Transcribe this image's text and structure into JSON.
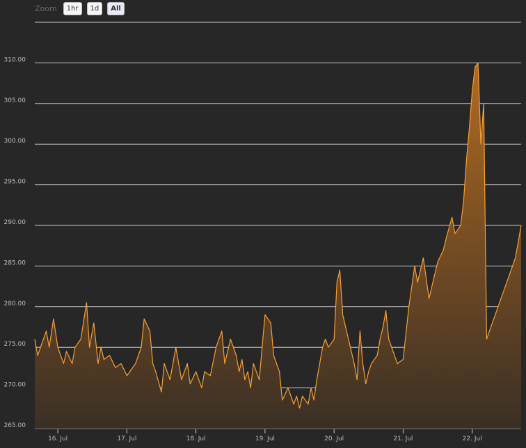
{
  "zoom": {
    "label": "Zoom",
    "buttons": [
      {
        "label": "1hr",
        "active": false
      },
      {
        "label": "1d",
        "active": false
      },
      {
        "label": "All",
        "active": true
      }
    ]
  },
  "colors": {
    "background": "#272727",
    "grid": "#c8c8c8",
    "line": "#f7a135",
    "fill_top": "#b06a21",
    "fill_bottom": "#3a2f25"
  },
  "chart_data": {
    "type": "area",
    "title": "",
    "xlabel": "",
    "ylabel": "",
    "grid": true,
    "legend": "none",
    "ylim": [
      265,
      315
    ],
    "yticks": [
      265,
      270,
      275,
      280,
      285,
      290,
      295,
      300,
      305,
      310
    ],
    "ytick_labels": [
      "265.00",
      "270.00",
      "275.00",
      "280.00",
      "285.00",
      "290.00",
      "295.00",
      "300.00",
      "305.00",
      "310.00"
    ],
    "xlim": [
      "2015-07-15T16:00",
      "2015-07-22T17:00"
    ],
    "xticks": [
      "2015-07-16",
      "2015-07-17",
      "2015-07-18",
      "2015-07-19",
      "2015-07-20",
      "2015-07-21",
      "2015-07-22"
    ],
    "xtick_labels": [
      "16. Jul",
      "17. Jul",
      "18. Jul",
      "19. Jul",
      "20. Jul",
      "21. Jul",
      "22. Jul"
    ],
    "series": [
      {
        "x": [
          "2015-07-15T16:00",
          "2015-07-15T17:00",
          "2015-07-15T19:00",
          "2015-07-15T20:00",
          "2015-07-15T21:00",
          "2015-07-15T22:30",
          "2015-07-16T00:00",
          "2015-07-16T01:00",
          "2015-07-16T02:00",
          "2015-07-16T03:00",
          "2015-07-16T05:00",
          "2015-07-16T06:00",
          "2015-07-16T08:00",
          "2015-07-16T10:00",
          "2015-07-16T11:00",
          "2015-07-16T12:00",
          "2015-07-16T12:30",
          "2015-07-16T14:00",
          "2015-07-16T15:00",
          "2015-07-16T16:00",
          "2015-07-16T18:00",
          "2015-07-16T20:00",
          "2015-07-16T22:00",
          "2015-07-17T00:00",
          "2015-07-17T03:00",
          "2015-07-17T05:00",
          "2015-07-17T06:00",
          "2015-07-17T08:00",
          "2015-07-17T09:00",
          "2015-07-17T10:00",
          "2015-07-17T12:00",
          "2015-07-17T13:00",
          "2015-07-17T15:00",
          "2015-07-17T17:00",
          "2015-07-17T19:00",
          "2015-07-17T21:00",
          "2015-07-17T22:00",
          "2015-07-18T00:00",
          "2015-07-18T02:00",
          "2015-07-18T03:00",
          "2015-07-18T05:00",
          "2015-07-18T07:00",
          "2015-07-18T09:00",
          "2015-07-18T10:00",
          "2015-07-18T12:00",
          "2015-07-18T14:00",
          "2015-07-18T15:00",
          "2015-07-18T16:00",
          "2015-07-18T17:00",
          "2015-07-18T18:00",
          "2015-07-18T19:00",
          "2015-07-18T20:00",
          "2015-07-18T22:00",
          "2015-07-19T00:00",
          "2015-07-19T02:00",
          "2015-07-19T03:00",
          "2015-07-19T05:00",
          "2015-07-19T06:00",
          "2015-07-19T08:00",
          "2015-07-19T10:00",
          "2015-07-19T11:00",
          "2015-07-19T12:00",
          "2015-07-19T13:00",
          "2015-07-19T15:00",
          "2015-07-19T16:00",
          "2015-07-19T17:00",
          "2015-07-19T18:00",
          "2015-07-19T19:00",
          "2015-07-19T20:00",
          "2015-07-19T21:00",
          "2015-07-19T22:00",
          "2015-07-20T00:00",
          "2015-07-20T01:00",
          "2015-07-20T02:00",
          "2015-07-20T03:00",
          "2015-07-20T05:00",
          "2015-07-20T07:00",
          "2015-07-20T08:00",
          "2015-07-20T09:00",
          "2015-07-20T10:00",
          "2015-07-20T11:00",
          "2015-07-20T12:00",
          "2015-07-20T13:00",
          "2015-07-20T15:00",
          "2015-07-20T16:00",
          "2015-07-20T17:00",
          "2015-07-20T18:00",
          "2015-07-20T19:00",
          "2015-07-20T20:00",
          "2015-07-20T21:00",
          "2015-07-20T22:00",
          "2015-07-21T00:00",
          "2015-07-21T02:00",
          "2015-07-21T04:00",
          "2015-07-21T05:00",
          "2015-07-21T07:00",
          "2015-07-21T09:00",
          "2015-07-21T11:00",
          "2015-07-21T12:00",
          "2015-07-21T14:00",
          "2015-07-21T15:00",
          "2015-07-21T17:00",
          "2015-07-21T18:00",
          "2015-07-21T20:00",
          "2015-07-21T21:00",
          "2015-07-21T22:00",
          "2015-07-21T23:00",
          "2015-07-22T00:00",
          "2015-07-22T01:00",
          "2015-07-22T02:00",
          "2015-07-22T03:00",
          "2015-07-22T04:00",
          "2015-07-22T05:00",
          "2015-07-22T06:00",
          "2015-07-22T07:00",
          "2015-07-22T08:00",
          "2015-07-22T09:00",
          "2015-07-22T10:00",
          "2015-07-22T11:00",
          "2015-07-22T12:00",
          "2015-07-22T13:00",
          "2015-07-22T14:00",
          "2015-07-22T15:00",
          "2015-07-22T15:30",
          "2015-07-22T16:00",
          "2015-07-22T16:30",
          "2015-07-22T17:00"
        ],
        "y": [
          276,
          274,
          276,
          277,
          275,
          278.5,
          275,
          274,
          273,
          274.5,
          273,
          275,
          276,
          280.5,
          275,
          277,
          278,
          273,
          275,
          273.5,
          274,
          272.5,
          273,
          271.5,
          273,
          275,
          278.5,
          277,
          273,
          272,
          269.5,
          273,
          271,
          275,
          271,
          273,
          270.5,
          272,
          270,
          272,
          271.5,
          275,
          277,
          273,
          276,
          274,
          272,
          273.5,
          271,
          272,
          270,
          273,
          271,
          279,
          278,
          274,
          272,
          268.5,
          270,
          268,
          269,
          267.5,
          269,
          268,
          270,
          268.5,
          271,
          273,
          275,
          276,
          275,
          276,
          283,
          284.5,
          279,
          276,
          273,
          271,
          277,
          273,
          270.5,
          272,
          273,
          274,
          276,
          277.5,
          279.5,
          276,
          275,
          274,
          273,
          273.5,
          280,
          285,
          283,
          286,
          281,
          284,
          285.5,
          287,
          288.5,
          291,
          289,
          290,
          293,
          298,
          302,
          306.5,
          309.5,
          310,
          300,
          305,
          276,
          277,
          278,
          279,
          280,
          281,
          282,
          283,
          284,
          285,
          286,
          287,
          288,
          289,
          290
        ]
      }
    ]
  }
}
